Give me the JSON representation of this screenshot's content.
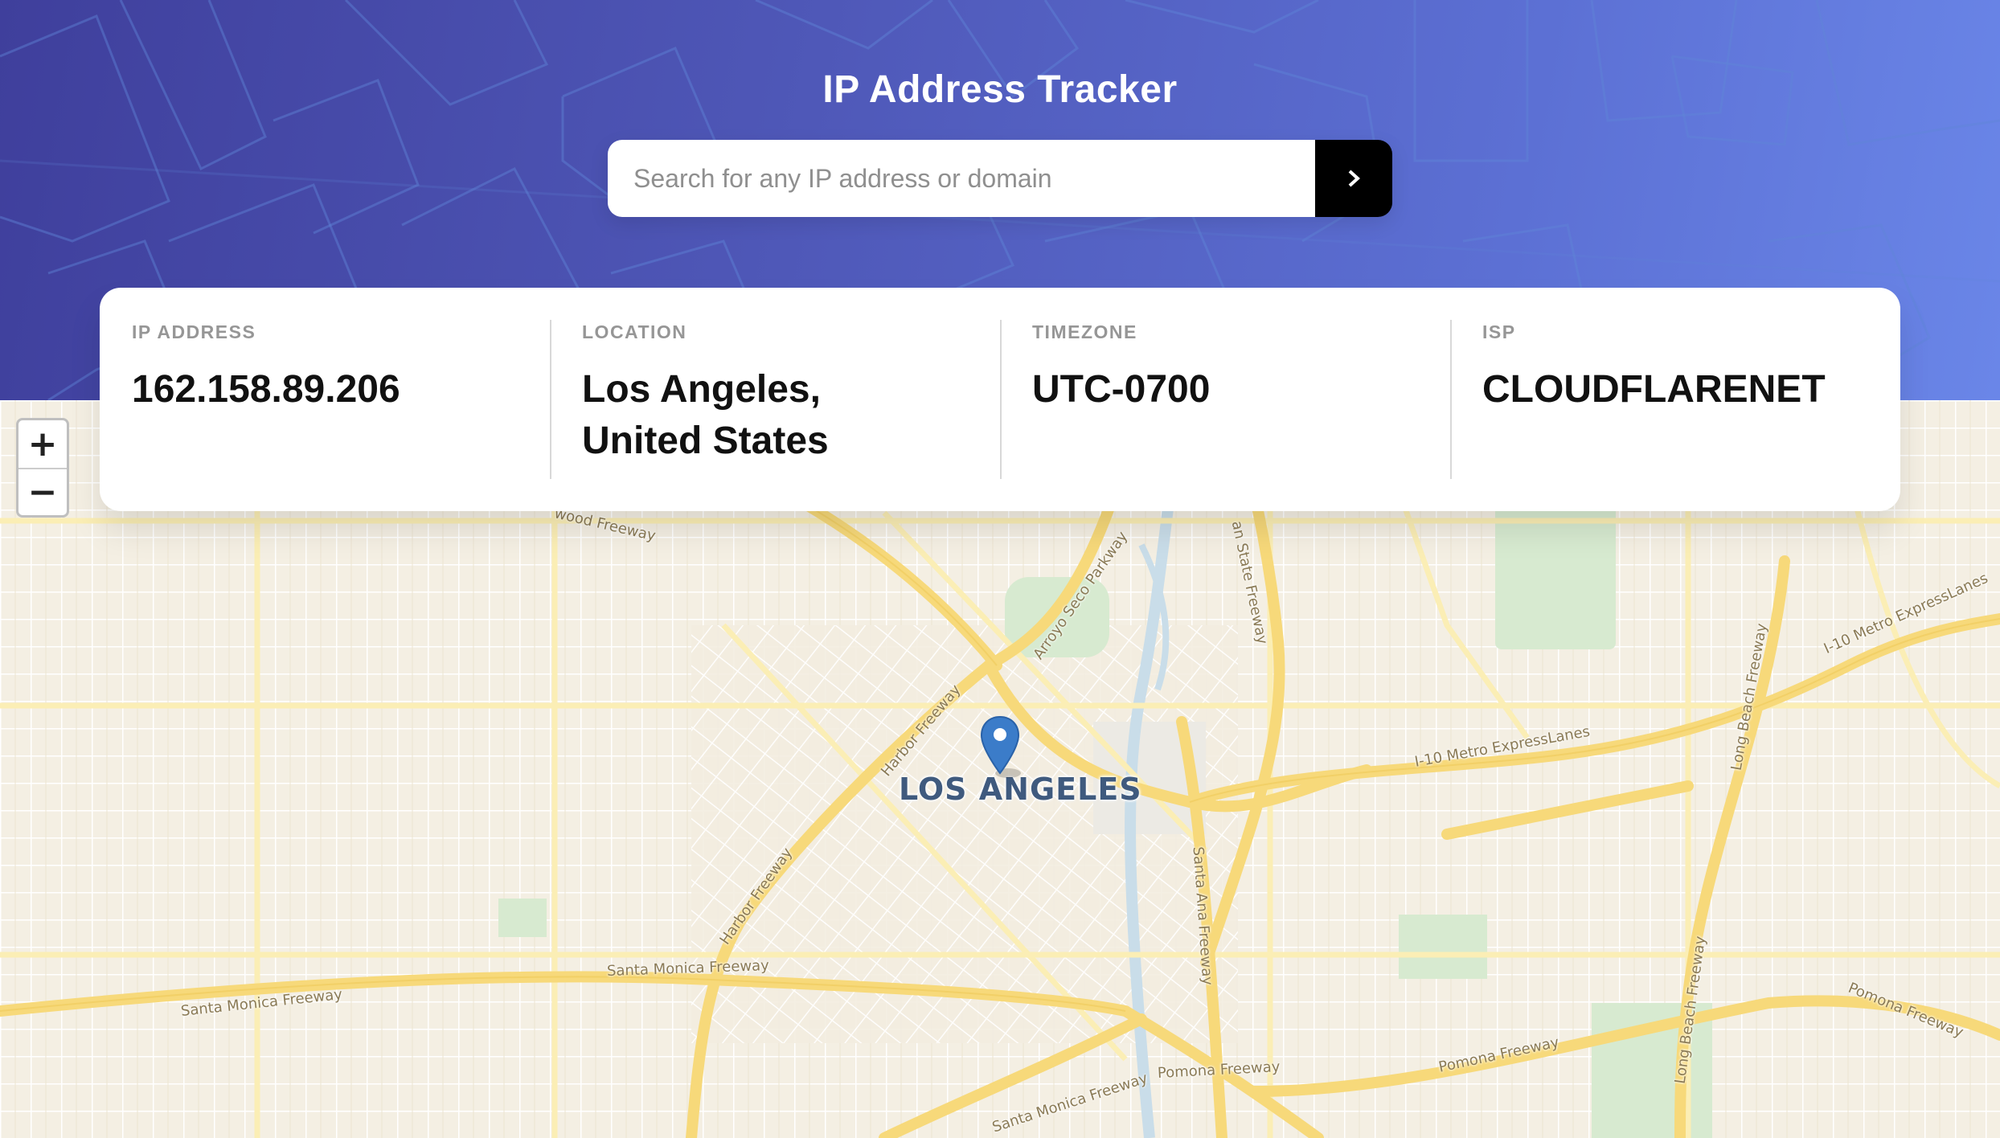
{
  "header": {
    "title": "IP Address Tracker",
    "gradient_start": "#3f3f9c",
    "gradient_end": "#6a86e8"
  },
  "search": {
    "placeholder": "Search for any IP address or domain",
    "value": "",
    "button_icon": "chevron-right-icon"
  },
  "info": {
    "ip_address": {
      "label": "IP ADDRESS",
      "value": "162.158.89.206"
    },
    "location": {
      "label": "LOCATION",
      "value_line1": "Los Angeles,",
      "value_line2": "United States"
    },
    "timezone": {
      "label": "TIMEZONE",
      "value": "UTC-0700"
    },
    "isp": {
      "label": "ISP",
      "value": "CLOUDFLARENET"
    }
  },
  "map": {
    "zoom_in_label": "+",
    "zoom_out_label": "−",
    "city": "LOS ANGELES",
    "marker_icon": "map-pin-icon",
    "marker_color": "#3b7cc9",
    "road_labels": {
      "freeway_top": "wood Freeway",
      "arroyo": "Arroyo Seco Parkway",
      "state_fwy": "an State Freeway",
      "harbor_top": "Harbor Freeway",
      "harbor_bottom": "Harbor Freeway",
      "santa_ana": "Santa Ana Freeway",
      "i10_center": "I-10 Metro ExpressLanes",
      "i10_right": "I-10 Metro ExpressLanes",
      "long_beach_top": "Long Beach Freeway",
      "long_beach_bottom": "Long Beach Freeway",
      "santa_monica_left": "Santa Monica Freeway",
      "santa_monica_center": "Santa Monica Freeway",
      "santa_monica_bottom": "Santa Monica Freeway",
      "pomona_center": "Pomona Freeway",
      "pomona_right": "Pomona Freeway",
      "pomona_far_right": "Pomona Freeway"
    }
  }
}
